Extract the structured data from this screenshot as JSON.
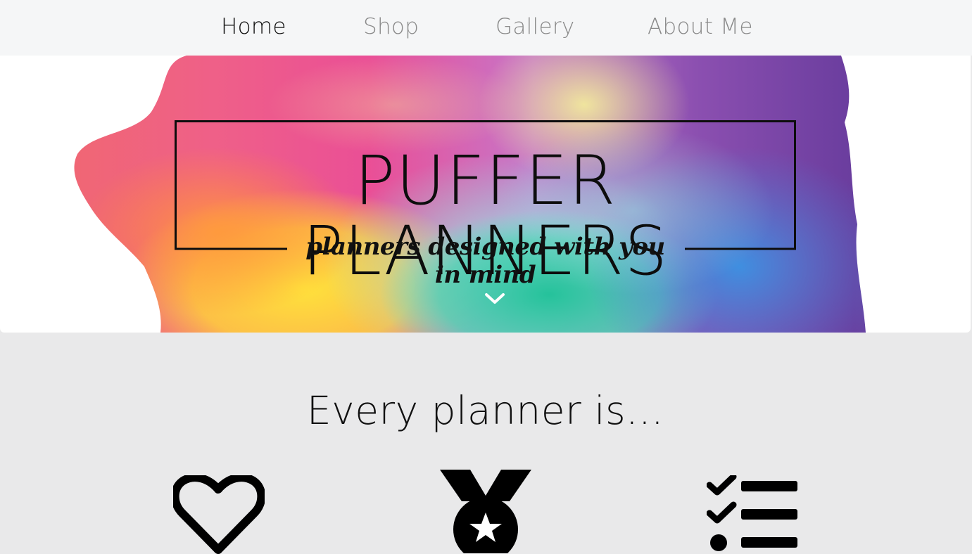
{
  "nav": {
    "items": [
      {
        "label": "Home",
        "active": true
      },
      {
        "label": "Shop",
        "active": false
      },
      {
        "label": "Gallery",
        "active": false
      },
      {
        "label": "About Me",
        "active": false
      }
    ]
  },
  "hero": {
    "brand_title": "PUFFER PLANNERS",
    "tagline": "planners designed with you in mind",
    "scroll_icon": "chevron-down-icon"
  },
  "features": {
    "title": "Every planner is...",
    "icons": [
      "heart-icon",
      "medal-icon",
      "checklist-icon"
    ]
  },
  "colors": {
    "nav_bg": "#f5f6f7",
    "section_bg": "#e9e9ea",
    "active_link": "#111111",
    "inactive_link": "#8a8a8a"
  }
}
